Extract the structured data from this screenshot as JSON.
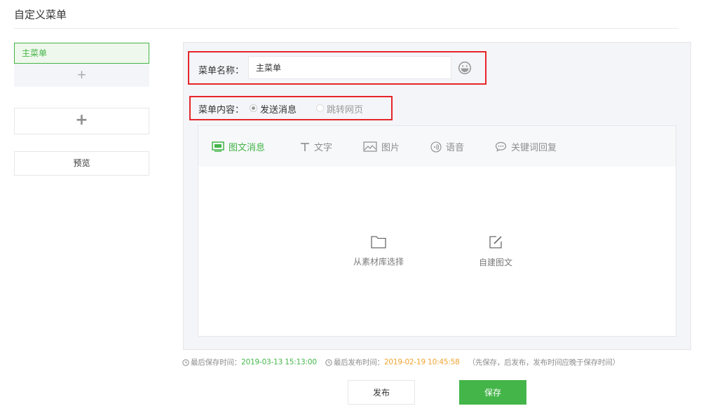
{
  "page": {
    "title": "自定义菜单"
  },
  "menu": {
    "main_item": "主菜单",
    "add_sub_label": "+",
    "add_main_label": "+",
    "preview_label": "预览"
  },
  "editor": {
    "name_label": "菜单名称：",
    "name_value": "主菜单",
    "content_label": "菜单内容：",
    "options": [
      {
        "label": "发送消息",
        "checked": true
      },
      {
        "label": "跳转网页",
        "checked": false
      }
    ],
    "tabs": [
      {
        "label": "图文消息",
        "icon": "news-icon",
        "active": true
      },
      {
        "label": "文字",
        "icon": "text-icon",
        "active": false
      },
      {
        "label": "图片",
        "icon": "image-icon",
        "active": false
      },
      {
        "label": "语音",
        "icon": "voice-icon",
        "active": false
      },
      {
        "label": "关键词回复",
        "icon": "keyword-reply-icon",
        "active": false
      }
    ],
    "actions": [
      {
        "label": "从素材库选择",
        "icon": "folder-icon"
      },
      {
        "label": "自建图文",
        "icon": "edit-icon"
      }
    ]
  },
  "footer": {
    "last_save_label": "最后保存时间：",
    "last_save_time": "2019-03-13 15:13:00",
    "last_publish_label": "最后发布时间：",
    "last_publish_time": "2019-02-19 10:45:58",
    "note": "（先保存，后发布，发布时间应晚于保存时间）",
    "publish_button": "发布",
    "save_button": "保存"
  },
  "colors": {
    "accent_green": "#44b549",
    "highlight_red": "#e5262a",
    "publish_time_orange": "#f0a330"
  }
}
